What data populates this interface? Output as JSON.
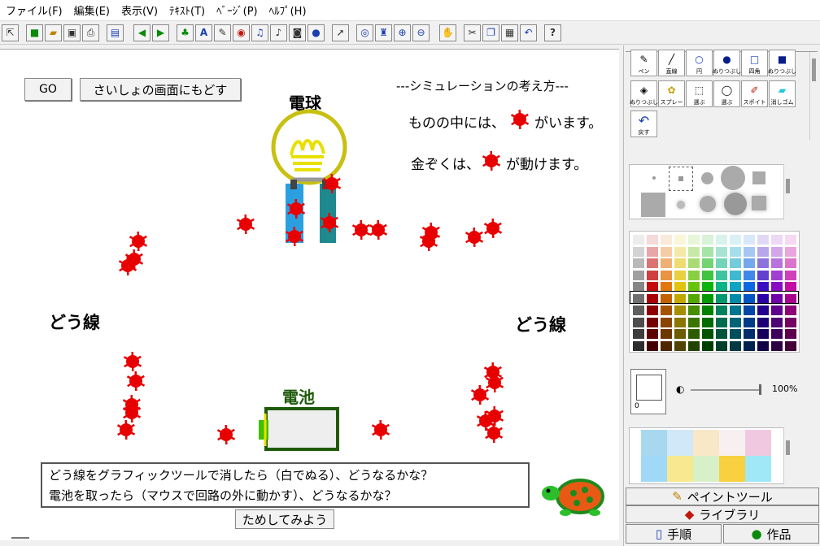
{
  "menu": [
    "ファイル(F)",
    "編集(E)",
    "表示(V)",
    "ﾃｷｽﾄ(T)",
    "ﾍﾞｰｼﾞ(P)",
    "ﾍﾙﾌﾟ(H)"
  ],
  "toolbar": {
    "help_label": "?"
  },
  "stage": {
    "go_label": "GO",
    "reset_label": "さいしょの画面にもどす",
    "bulb_label": "電球",
    "battery_label": "電池",
    "wire_left_label": "どう線",
    "wire_right_label": "どう線",
    "sim_heading": "---シミュレーションの考え方---",
    "sim_line1_a": "ものの中には、",
    "sim_line1_b": "がいます。",
    "sim_line2_a": "金ぞくは、",
    "sim_line2_b": "が動けます。",
    "question1": "どう線をグラフィックツールで消したら（白でぬる）、どうなるかな？",
    "question2": "電池を取ったら（マウスで回路の外に動かす）、どうなるかな？",
    "try_label": "ためしてみよう"
  },
  "paint": {
    "tools": [
      "ペン",
      "直線",
      "円",
      "ぬりつぶし",
      "四角",
      "ぬりつぶし",
      "ぬりつぶし",
      "スプレー",
      "選ぶ",
      "選ぶ",
      "スポイト",
      "消しゴム",
      "戻す"
    ],
    "zoom_text": "100%",
    "width_value": "0",
    "palette_columns": [
      "#808080",
      "#c00000",
      "#e07000",
      "#e0c000",
      "#60c000",
      "#00b000",
      "#00b080",
      "#00a0c0",
      "#0060e0",
      "#3000c0",
      "#8000c0",
      "#c000a0"
    ],
    "tab_paint": "ペイントツール",
    "tab_library": "ライブラリ",
    "tab_steps": "手順",
    "tab_works": "作品"
  },
  "colors": {
    "wire_blue": "#0a1eb4",
    "wire_cyan": "#1ecbd8",
    "wire_green": "#08a818",
    "wire_purple": "#8000c8",
    "wire_pink": "#ff60ff",
    "bulb": "#c8c010",
    "battery": "#1e5a0a",
    "electron": "#e80000"
  }
}
